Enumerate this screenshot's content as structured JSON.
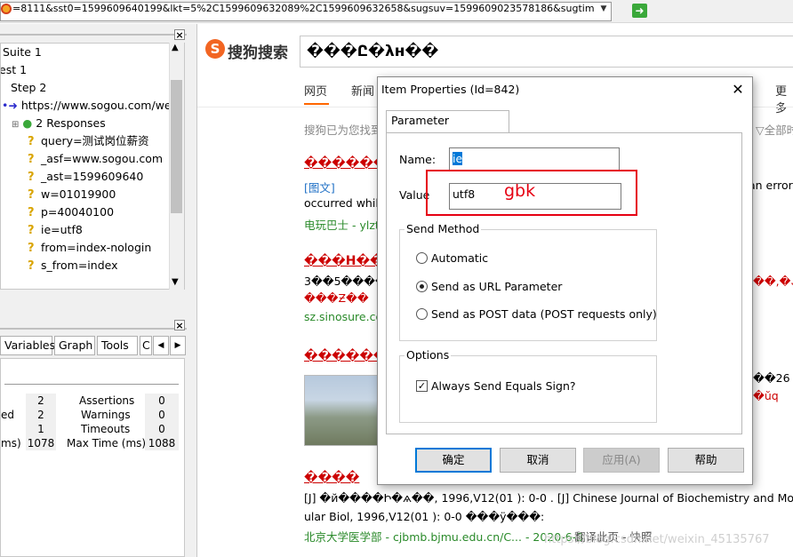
{
  "url_bar": {
    "url": "=8111&sst0=1599609640199&lkt=5%2C1599609632089%2C1599609632658&sugsuv=1599609023578186&sugtime=1599609640199",
    "go_icon": "green-arrow-icon"
  },
  "tree": {
    "items": [
      {
        "label": "Suite 1"
      },
      {
        "label": "est 1"
      },
      {
        "label": "Step 2"
      },
      {
        "label": "https://www.sogou.com/wel"
      },
      {
        "label": "2 Responses"
      },
      {
        "label": "query=测试岗位薪资"
      },
      {
        "label": "_asf=www.sogou.com"
      },
      {
        "label": "_ast=1599609640"
      },
      {
        "label": "w=01019900"
      },
      {
        "label": "p=40040100"
      },
      {
        "label": "ie=utf8"
      },
      {
        "label": "from=index-nologin"
      },
      {
        "label": "s_from=index"
      }
    ]
  },
  "bottom_tabs": [
    "Variables",
    "Graph",
    "Tools",
    "C"
  ],
  "stats": {
    "row1": {
      "left_value": "2",
      "label": "Assertions",
      "right_value": "0"
    },
    "row2": {
      "left_label": "ed",
      "left_value": "2",
      "label": "Warnings",
      "right_value": "0"
    },
    "row3": {
      "left_value": "1",
      "label": "Timeouts",
      "right_value": "0"
    },
    "row4": {
      "left_label": "ms)",
      "left_value": "1078",
      "label": "Max Time (ms)",
      "right_value": "1088"
    }
  },
  "sogou": {
    "logo_text": "搜狗搜索",
    "search_text": "���Ը�λн��",
    "nav": [
      "网页",
      "新闻",
      "更多"
    ],
    "info_text": "搜狗已为您找到",
    "filter_text": "全部时",
    "results": [
      {
        "title": "������",
        "tag": "[图文]",
        "snippet_tail": "occurred while",
        "snippet_right": "an error",
        "source": "电玩巴士 - ylzt"
      },
      {
        "title": "���Н��",
        "snippet": "3��5����",
        "snippet2": "���Ƶ��",
        "snippet_right": "��,�ڭ",
        "source": "sz.sinosure.co"
      },
      {
        "title": "������",
        "snippet_right": "��26",
        "snippet_right2": "�ŭq"
      },
      {
        "title": "����",
        "snippet": "[J] �й����Ի�ѧ��,  1996,V12(01 ): 0-0 . [J] Chinese Journal of Biochemistry and Molec",
        "snippet2": "ular Biol, 1996,V12(01 ): 0-0 ���ÿ���:",
        "source": "北京大学医学部 - cjbmb.bjmu.edu.cn/C... - 2020-6-3",
        "links": "翻译此页  - 快照"
      }
    ]
  },
  "dialog": {
    "title": "Item Properties (Id=842)",
    "tab": "Parameter Properties",
    "name_label": "Name:",
    "name_value": "ie",
    "value_label": "Value",
    "value_value": "utf8",
    "send_method_title": "Send Method",
    "send_options": [
      "Automatic",
      "Send as URL Parameter",
      "Send as POST data (POST requests only)"
    ],
    "selected_send": "Send as URL Parameter",
    "options_title": "Options",
    "always_send_label": "Always Send Equals Sign?",
    "always_send_checked": true,
    "buttons": {
      "ok": "确定",
      "cancel": "取消",
      "apply": "应用(A)",
      "help": "帮助"
    }
  },
  "annotation": {
    "text": "gbk",
    "color": "#e60012"
  },
  "watermark": "https://blog.csdn.net/weixin_45135767"
}
